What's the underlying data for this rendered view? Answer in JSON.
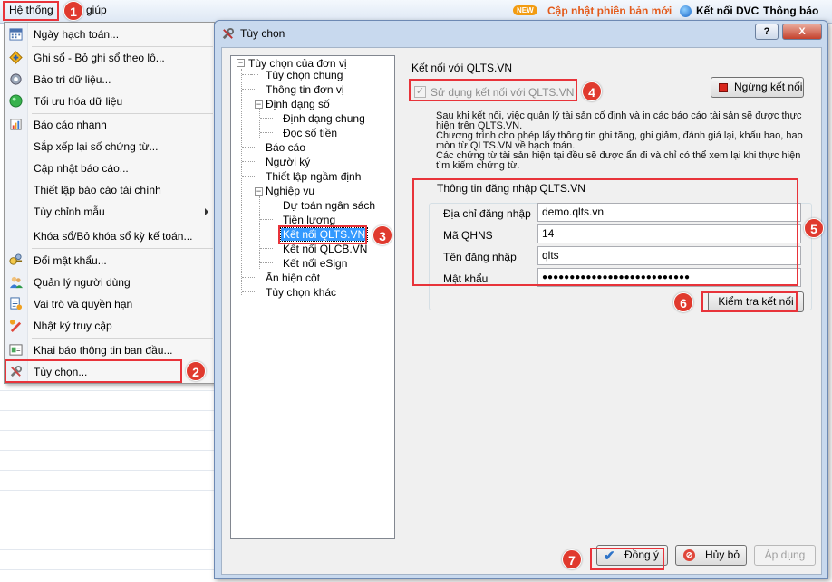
{
  "menubar": {
    "system_menu": "Hệ thống",
    "help_menu": "Trợ giúp",
    "help_menu_visible": "giúp",
    "new_badge": "NEW",
    "update_link": "Cập nhật phiên bản mới",
    "dvc_link": "Kết nối DVC",
    "notify_link": "Thông báo"
  },
  "dropdown": {
    "items": [
      {
        "label": "Ngày hạch toán...",
        "icon": "calendar-icon"
      },
      {
        "label": "Ghi sổ - Bỏ ghi sổ theo lô...",
        "icon": "post-ledger-icon"
      },
      {
        "label": "Bảo trì dữ liệu...",
        "icon": "maintenance-icon"
      },
      {
        "label": "Tối ưu hóa dữ liệu",
        "icon": "optimize-icon"
      },
      {
        "label": "Báo cáo nhanh",
        "icon": "quick-report-icon"
      },
      {
        "label": "Sắp xếp lại số chứng từ...",
        "icon": ""
      },
      {
        "label": "Cập nhật báo cáo...",
        "icon": ""
      },
      {
        "label": "Thiết lập báo cáo tài chính",
        "icon": ""
      },
      {
        "label": "Tùy chỉnh mẫu",
        "icon": ""
      },
      {
        "label": "Khóa sổ/Bỏ khóa sổ kỳ kế toán...",
        "icon": ""
      },
      {
        "label": "Đổi mật khẩu...",
        "icon": "change-password-icon"
      },
      {
        "label": "Quản lý người dùng",
        "icon": "users-icon"
      },
      {
        "label": "Vai trò và quyền hạn",
        "icon": "roles-icon"
      },
      {
        "label": "Nhật ký truy cập",
        "icon": "access-log-icon"
      },
      {
        "label": "Khai báo thông tin ban đầu...",
        "icon": "initial-setup-icon"
      },
      {
        "label": "Tùy chọn...",
        "icon": "options-icon"
      }
    ]
  },
  "dialog": {
    "title": "Tùy chọn",
    "help_button": "?",
    "close_button": "X",
    "tree": {
      "root": "Tùy chọn của đơn vị",
      "n1": "Tùy chọn chung",
      "n2": "Thông tin đơn vị",
      "n3": "Định dạng số",
      "n3a": "Định dạng chung",
      "n3b": "Đọc số tiền",
      "n4": "Báo cáo",
      "n5": "Người ký",
      "n6": "Thiết lập ngầm định",
      "n7": "Nghiệp vụ",
      "n7a": "Dự toán ngân sách",
      "n7b": "Tiền lương",
      "n7c": "Kết nối QLTS.VN",
      "n7d": "Kết nối QLCB.VN",
      "n7e": "Kết nối eSign",
      "n8": "Ẩn hiện cột",
      "n9": "Tùy chọn khác"
    },
    "group_title": "Kết nối với QLTS.VN",
    "use_connection_label": "Sử dụng kết nối với QLTS.VN",
    "use_connection_checked": true,
    "disconnect_button": "Ngừng kết nối",
    "desc_lines": [
      "Sau khi kết nối, việc quản lý tài sản cố định và in các báo cáo tài sản sẽ được thực",
      "hiện trên QLTS.VN.",
      "Chương trình cho phép lấy thông tin ghi tăng, ghi giảm, đánh giá lại, khấu hao, hao",
      "mòn từ QLTS.VN về hạch toán.",
      "Các chứng từ tài sản hiện tại đều sẽ được ẩn đi và chỉ có thể xem lại khi thực hiện",
      "tìm kiếm chứng từ."
    ],
    "login_group_title": "Thông tin đăng nhập QLTS.VN",
    "fields": [
      {
        "label": "Địa chỉ đăng nhập",
        "value": "demo.qlts.vn"
      },
      {
        "label": "Mã QHNS",
        "value": "14"
      },
      {
        "label": "Tên đăng nhập",
        "value": "qlts"
      },
      {
        "label": "Mật khẩu",
        "value": "●●●●●●●●●●●●●●●●●●●●●●●●●●●"
      }
    ],
    "check_connection_button": "Kiểm tra kết nối",
    "ok_button": "Đồng ý",
    "cancel_button": "Hủy bỏ",
    "apply_button": "Áp dụng"
  },
  "callouts": [
    "1",
    "2",
    "3",
    "4",
    "5",
    "6",
    "7"
  ],
  "colors": {
    "callout": "#e03a2e",
    "highlight_border": "#e8333a",
    "selected_bg": "#3399ff",
    "update_link": "#e35a1a"
  }
}
